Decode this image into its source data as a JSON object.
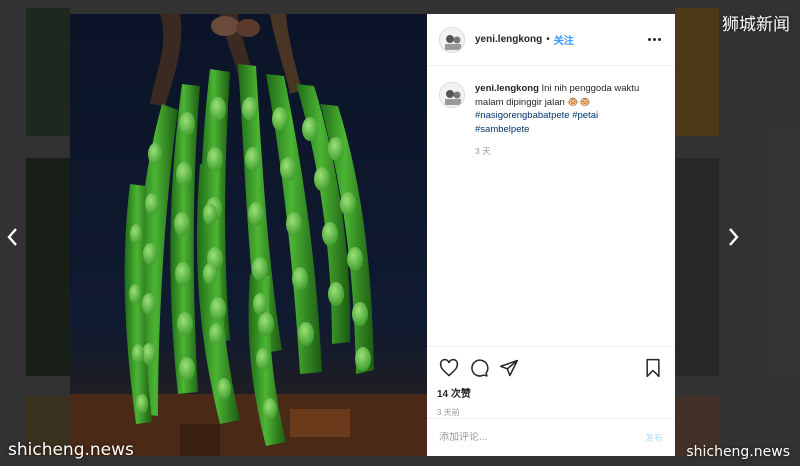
{
  "watermarks": {
    "top_right": "狮城新闻",
    "bottom_left": "shicheng.news",
    "bottom_right": "shicheng.news"
  },
  "post": {
    "username": "yeni.lengkong",
    "separator": "•",
    "follow_label": "关注",
    "caption_text": "Ini nih penggoda waktu malam dipinggir jalan 🐵🐵",
    "hashtags": [
      "#nasigorengbabatpete",
      "#petai",
      "#sambelpete"
    ],
    "caption_time": "3 天",
    "likes": "14 次赞",
    "post_time": "3 天前",
    "comment_placeholder": "添加评论...",
    "post_button": "发布"
  },
  "icons": {
    "more": "more-options-icon",
    "like": "heart-icon",
    "comment": "comment-icon",
    "share": "send-icon",
    "save": "bookmark-icon",
    "prev": "chevron-left-icon",
    "next": "chevron-right-icon"
  },
  "colors": {
    "link": "#3897f0",
    "hashtag": "#003569",
    "pod_green": "#3fa02a",
    "photo_bg": "#0a1222"
  }
}
